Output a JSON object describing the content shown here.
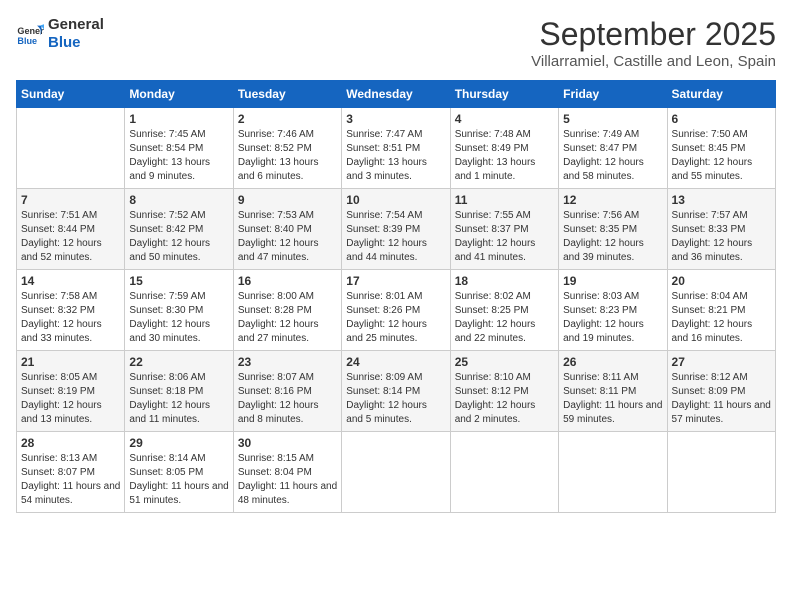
{
  "logo": {
    "line1": "General",
    "line2": "Blue"
  },
  "title": "September 2025",
  "subtitle": "Villarramiel, Castille and Leon, Spain",
  "headers": [
    "Sunday",
    "Monday",
    "Tuesday",
    "Wednesday",
    "Thursday",
    "Friday",
    "Saturday"
  ],
  "weeks": [
    [
      {
        "day": "",
        "sunrise": "",
        "sunset": "",
        "daylight": ""
      },
      {
        "day": "1",
        "sunrise": "Sunrise: 7:45 AM",
        "sunset": "Sunset: 8:54 PM",
        "daylight": "Daylight: 13 hours and 9 minutes."
      },
      {
        "day": "2",
        "sunrise": "Sunrise: 7:46 AM",
        "sunset": "Sunset: 8:52 PM",
        "daylight": "Daylight: 13 hours and 6 minutes."
      },
      {
        "day": "3",
        "sunrise": "Sunrise: 7:47 AM",
        "sunset": "Sunset: 8:51 PM",
        "daylight": "Daylight: 13 hours and 3 minutes."
      },
      {
        "day": "4",
        "sunrise": "Sunrise: 7:48 AM",
        "sunset": "Sunset: 8:49 PM",
        "daylight": "Daylight: 13 hours and 1 minute."
      },
      {
        "day": "5",
        "sunrise": "Sunrise: 7:49 AM",
        "sunset": "Sunset: 8:47 PM",
        "daylight": "Daylight: 12 hours and 58 minutes."
      },
      {
        "day": "6",
        "sunrise": "Sunrise: 7:50 AM",
        "sunset": "Sunset: 8:45 PM",
        "daylight": "Daylight: 12 hours and 55 minutes."
      }
    ],
    [
      {
        "day": "7",
        "sunrise": "Sunrise: 7:51 AM",
        "sunset": "Sunset: 8:44 PM",
        "daylight": "Daylight: 12 hours and 52 minutes."
      },
      {
        "day": "8",
        "sunrise": "Sunrise: 7:52 AM",
        "sunset": "Sunset: 8:42 PM",
        "daylight": "Daylight: 12 hours and 50 minutes."
      },
      {
        "day": "9",
        "sunrise": "Sunrise: 7:53 AM",
        "sunset": "Sunset: 8:40 PM",
        "daylight": "Daylight: 12 hours and 47 minutes."
      },
      {
        "day": "10",
        "sunrise": "Sunrise: 7:54 AM",
        "sunset": "Sunset: 8:39 PM",
        "daylight": "Daylight: 12 hours and 44 minutes."
      },
      {
        "day": "11",
        "sunrise": "Sunrise: 7:55 AM",
        "sunset": "Sunset: 8:37 PM",
        "daylight": "Daylight: 12 hours and 41 minutes."
      },
      {
        "day": "12",
        "sunrise": "Sunrise: 7:56 AM",
        "sunset": "Sunset: 8:35 PM",
        "daylight": "Daylight: 12 hours and 39 minutes."
      },
      {
        "day": "13",
        "sunrise": "Sunrise: 7:57 AM",
        "sunset": "Sunset: 8:33 PM",
        "daylight": "Daylight: 12 hours and 36 minutes."
      }
    ],
    [
      {
        "day": "14",
        "sunrise": "Sunrise: 7:58 AM",
        "sunset": "Sunset: 8:32 PM",
        "daylight": "Daylight: 12 hours and 33 minutes."
      },
      {
        "day": "15",
        "sunrise": "Sunrise: 7:59 AM",
        "sunset": "Sunset: 8:30 PM",
        "daylight": "Daylight: 12 hours and 30 minutes."
      },
      {
        "day": "16",
        "sunrise": "Sunrise: 8:00 AM",
        "sunset": "Sunset: 8:28 PM",
        "daylight": "Daylight: 12 hours and 27 minutes."
      },
      {
        "day": "17",
        "sunrise": "Sunrise: 8:01 AM",
        "sunset": "Sunset: 8:26 PM",
        "daylight": "Daylight: 12 hours and 25 minutes."
      },
      {
        "day": "18",
        "sunrise": "Sunrise: 8:02 AM",
        "sunset": "Sunset: 8:25 PM",
        "daylight": "Daylight: 12 hours and 22 minutes."
      },
      {
        "day": "19",
        "sunrise": "Sunrise: 8:03 AM",
        "sunset": "Sunset: 8:23 PM",
        "daylight": "Daylight: 12 hours and 19 minutes."
      },
      {
        "day": "20",
        "sunrise": "Sunrise: 8:04 AM",
        "sunset": "Sunset: 8:21 PM",
        "daylight": "Daylight: 12 hours and 16 minutes."
      }
    ],
    [
      {
        "day": "21",
        "sunrise": "Sunrise: 8:05 AM",
        "sunset": "Sunset: 8:19 PM",
        "daylight": "Daylight: 12 hours and 13 minutes."
      },
      {
        "day": "22",
        "sunrise": "Sunrise: 8:06 AM",
        "sunset": "Sunset: 8:18 PM",
        "daylight": "Daylight: 12 hours and 11 minutes."
      },
      {
        "day": "23",
        "sunrise": "Sunrise: 8:07 AM",
        "sunset": "Sunset: 8:16 PM",
        "daylight": "Daylight: 12 hours and 8 minutes."
      },
      {
        "day": "24",
        "sunrise": "Sunrise: 8:09 AM",
        "sunset": "Sunset: 8:14 PM",
        "daylight": "Daylight: 12 hours and 5 minutes."
      },
      {
        "day": "25",
        "sunrise": "Sunrise: 8:10 AM",
        "sunset": "Sunset: 8:12 PM",
        "daylight": "Daylight: 12 hours and 2 minutes."
      },
      {
        "day": "26",
        "sunrise": "Sunrise: 8:11 AM",
        "sunset": "Sunset: 8:11 PM",
        "daylight": "Daylight: 11 hours and 59 minutes."
      },
      {
        "day": "27",
        "sunrise": "Sunrise: 8:12 AM",
        "sunset": "Sunset: 8:09 PM",
        "daylight": "Daylight: 11 hours and 57 minutes."
      }
    ],
    [
      {
        "day": "28",
        "sunrise": "Sunrise: 8:13 AM",
        "sunset": "Sunset: 8:07 PM",
        "daylight": "Daylight: 11 hours and 54 minutes."
      },
      {
        "day": "29",
        "sunrise": "Sunrise: 8:14 AM",
        "sunset": "Sunset: 8:05 PM",
        "daylight": "Daylight: 11 hours and 51 minutes."
      },
      {
        "day": "30",
        "sunrise": "Sunrise: 8:15 AM",
        "sunset": "Sunset: 8:04 PM",
        "daylight": "Daylight: 11 hours and 48 minutes."
      },
      {
        "day": "",
        "sunrise": "",
        "sunset": "",
        "daylight": ""
      },
      {
        "day": "",
        "sunrise": "",
        "sunset": "",
        "daylight": ""
      },
      {
        "day": "",
        "sunrise": "",
        "sunset": "",
        "daylight": ""
      },
      {
        "day": "",
        "sunrise": "",
        "sunset": "",
        "daylight": ""
      }
    ]
  ]
}
